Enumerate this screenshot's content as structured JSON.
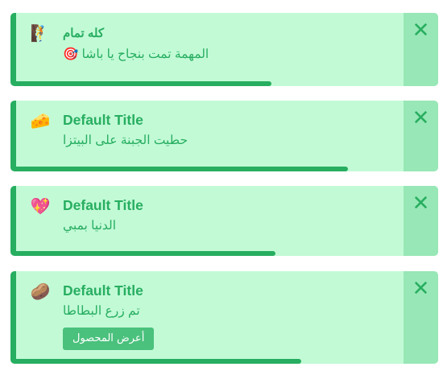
{
  "toasts": [
    {
      "icon": "🧗",
      "icon_name": "climbing-person-icon",
      "title": "كله تمام",
      "message": "المهمة تمت بنجاح يا باشا 🎯",
      "close_label": "✕",
      "progress": 0.61
    },
    {
      "icon": "🧀",
      "icon_name": "cheese-icon",
      "title": "Default Title",
      "message": "حطيت الجبنة على البيتزا",
      "close_label": "✕",
      "progress": 0.79
    },
    {
      "icon": "💖",
      "icon_name": "sparkling-heart-icon",
      "title": "Default Title",
      "message": "الدنيا بمبي",
      "close_label": "✕",
      "progress": 0.62
    },
    {
      "icon": "🥔",
      "icon_name": "potato-icon",
      "title": "Default Title",
      "message": "تم زرع البطاطا",
      "close_label": "✕",
      "action_label": "أعرض المحصول",
      "progress": 0.68
    }
  ],
  "colors": {
    "background": "#c2fad6",
    "accent": "#27ae60",
    "close_bg": "#98e7b6",
    "button_bg": "#4ac17c"
  }
}
